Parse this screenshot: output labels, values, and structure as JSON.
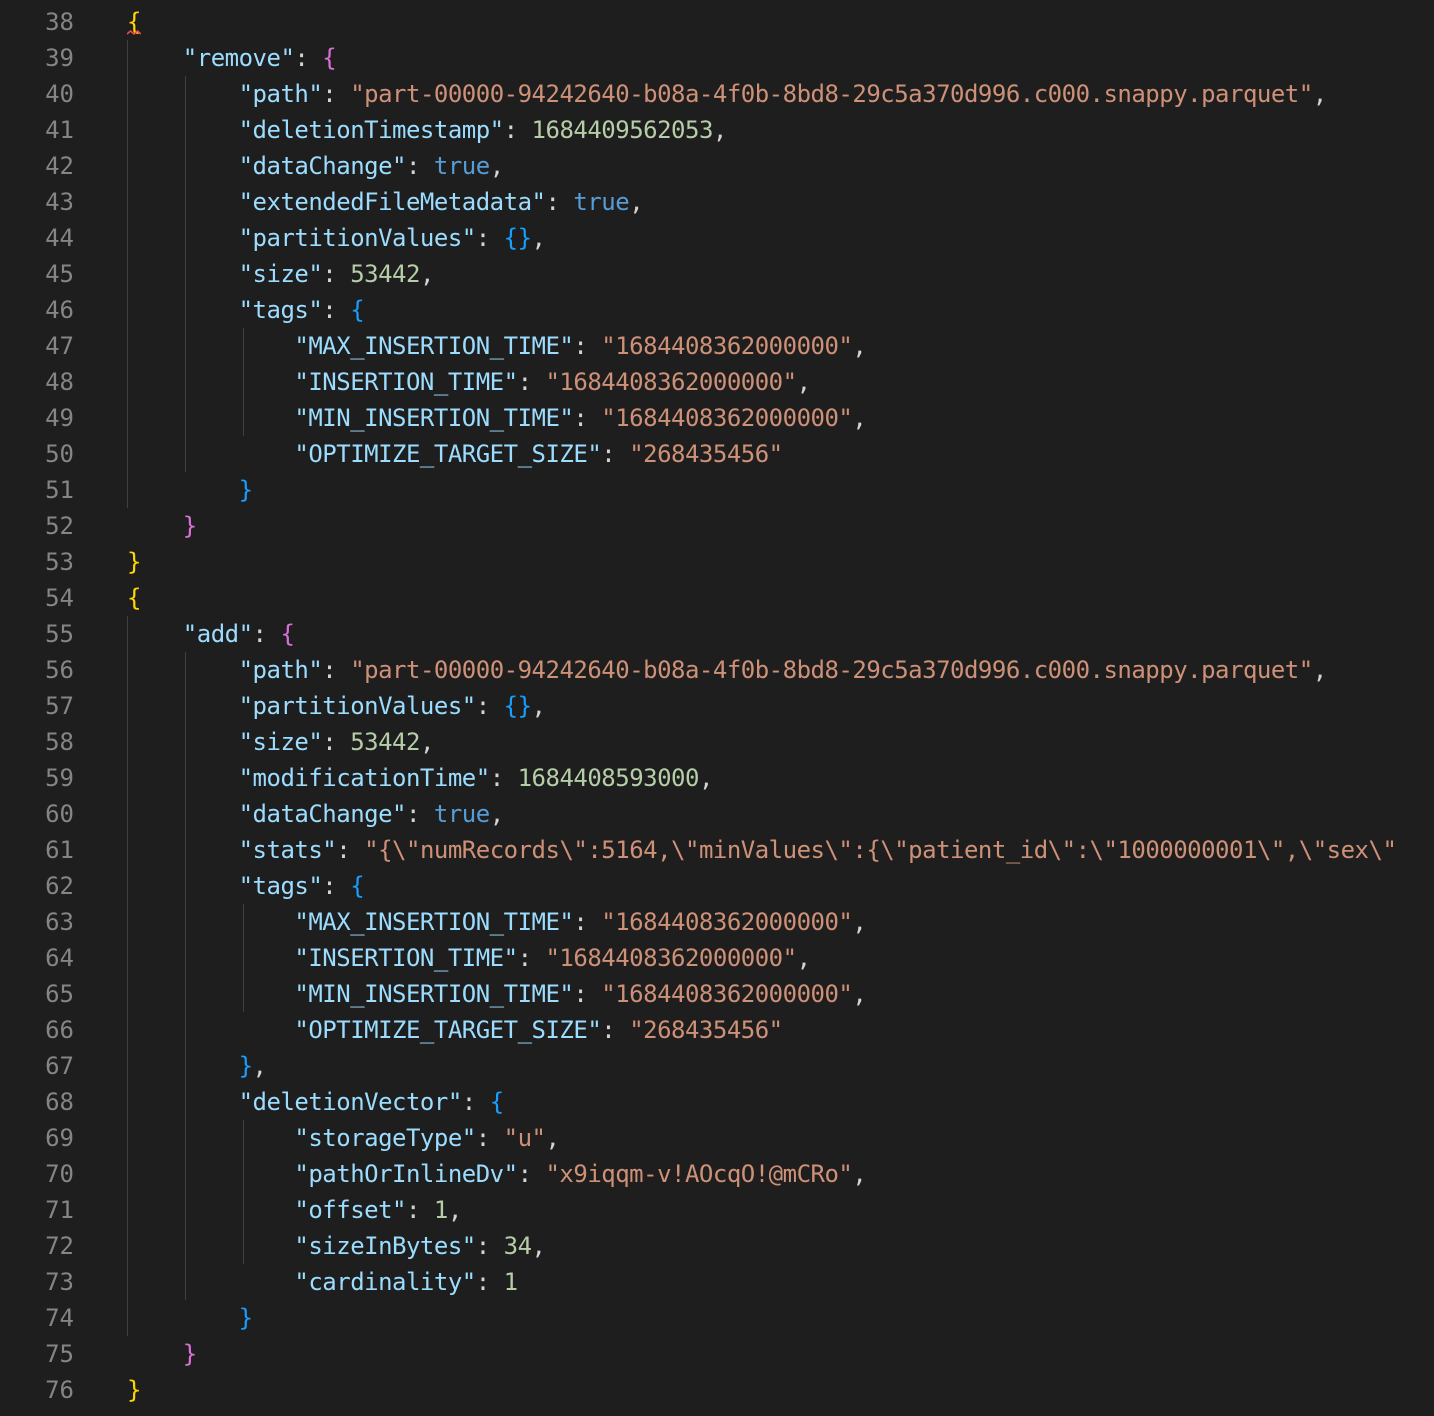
{
  "editor": {
    "language": "json",
    "theme_colors": {
      "background": "#1e1e1e",
      "line_number": "#858585",
      "punctuation": "#d4d4d4",
      "bracket_level1": "#ffd700",
      "bracket_level2": "#da70d6",
      "bracket_level3": "#179fff",
      "key": "#9cdcfe",
      "string": "#ce9178",
      "number": "#b5cea8",
      "keyword": "#569cd6"
    },
    "lines": [
      {
        "n": "38",
        "tokens": [
          [
            "b1",
            "{"
          ]
        ]
      },
      {
        "n": "39",
        "tokens": [
          [
            "pun",
            "    "
          ],
          [
            "key",
            "\"remove\""
          ],
          [
            "pun",
            ": "
          ],
          [
            "b2",
            "{"
          ]
        ]
      },
      {
        "n": "40",
        "tokens": [
          [
            "pun",
            "        "
          ],
          [
            "key",
            "\"path\""
          ],
          [
            "pun",
            ": "
          ],
          [
            "str",
            "\"part-00000-94242640-b08a-4f0b-8bd8-29c5a370d996.c000.snappy.parquet\""
          ],
          [
            "pun",
            ","
          ]
        ]
      },
      {
        "n": "41",
        "tokens": [
          [
            "pun",
            "        "
          ],
          [
            "key",
            "\"deletionTimestamp\""
          ],
          [
            "pun",
            ": "
          ],
          [
            "num",
            "1684409562053"
          ],
          [
            "pun",
            ","
          ]
        ]
      },
      {
        "n": "42",
        "tokens": [
          [
            "pun",
            "        "
          ],
          [
            "key",
            "\"dataChange\""
          ],
          [
            "pun",
            ": "
          ],
          [
            "kw",
            "true"
          ],
          [
            "pun",
            ","
          ]
        ]
      },
      {
        "n": "43",
        "tokens": [
          [
            "pun",
            "        "
          ],
          [
            "key",
            "\"extendedFileMetadata\""
          ],
          [
            "pun",
            ": "
          ],
          [
            "kw",
            "true"
          ],
          [
            "pun",
            ","
          ]
        ]
      },
      {
        "n": "44",
        "tokens": [
          [
            "pun",
            "        "
          ],
          [
            "key",
            "\"partitionValues\""
          ],
          [
            "pun",
            ": "
          ],
          [
            "b3",
            "{}"
          ],
          [
            "pun",
            ","
          ]
        ]
      },
      {
        "n": "45",
        "tokens": [
          [
            "pun",
            "        "
          ],
          [
            "key",
            "\"size\""
          ],
          [
            "pun",
            ": "
          ],
          [
            "num",
            "53442"
          ],
          [
            "pun",
            ","
          ]
        ]
      },
      {
        "n": "46",
        "tokens": [
          [
            "pun",
            "        "
          ],
          [
            "key",
            "\"tags\""
          ],
          [
            "pun",
            ": "
          ],
          [
            "b3",
            "{"
          ]
        ]
      },
      {
        "n": "47",
        "tokens": [
          [
            "pun",
            "            "
          ],
          [
            "key",
            "\"MAX_INSERTION_TIME\""
          ],
          [
            "pun",
            ": "
          ],
          [
            "str",
            "\"1684408362000000\""
          ],
          [
            "pun",
            ","
          ]
        ]
      },
      {
        "n": "48",
        "tokens": [
          [
            "pun",
            "            "
          ],
          [
            "key",
            "\"INSERTION_TIME\""
          ],
          [
            "pun",
            ": "
          ],
          [
            "str",
            "\"1684408362000000\""
          ],
          [
            "pun",
            ","
          ]
        ]
      },
      {
        "n": "49",
        "tokens": [
          [
            "pun",
            "            "
          ],
          [
            "key",
            "\"MIN_INSERTION_TIME\""
          ],
          [
            "pun",
            ": "
          ],
          [
            "str",
            "\"1684408362000000\""
          ],
          [
            "pun",
            ","
          ]
        ]
      },
      {
        "n": "50",
        "tokens": [
          [
            "pun",
            "            "
          ],
          [
            "key",
            "\"OPTIMIZE_TARGET_SIZE\""
          ],
          [
            "pun",
            ": "
          ],
          [
            "str",
            "\"268435456\""
          ]
        ]
      },
      {
        "n": "51",
        "tokens": [
          [
            "pun",
            "        "
          ],
          [
            "b3",
            "}"
          ]
        ]
      },
      {
        "n": "52",
        "tokens": [
          [
            "pun",
            "    "
          ],
          [
            "b2",
            "}"
          ]
        ]
      },
      {
        "n": "53",
        "tokens": [
          [
            "b1",
            "}"
          ]
        ]
      },
      {
        "n": "54",
        "tokens": [
          [
            "b1",
            "{"
          ]
        ]
      },
      {
        "n": "55",
        "tokens": [
          [
            "pun",
            "    "
          ],
          [
            "key",
            "\"add\""
          ],
          [
            "pun",
            ": "
          ],
          [
            "b2",
            "{"
          ]
        ]
      },
      {
        "n": "56",
        "tokens": [
          [
            "pun",
            "        "
          ],
          [
            "key",
            "\"path\""
          ],
          [
            "pun",
            ": "
          ],
          [
            "str",
            "\"part-00000-94242640-b08a-4f0b-8bd8-29c5a370d996.c000.snappy.parquet\""
          ],
          [
            "pun",
            ","
          ]
        ]
      },
      {
        "n": "57",
        "tokens": [
          [
            "pun",
            "        "
          ],
          [
            "key",
            "\"partitionValues\""
          ],
          [
            "pun",
            ": "
          ],
          [
            "b3",
            "{}"
          ],
          [
            "pun",
            ","
          ]
        ]
      },
      {
        "n": "58",
        "tokens": [
          [
            "pun",
            "        "
          ],
          [
            "key",
            "\"size\""
          ],
          [
            "pun",
            ": "
          ],
          [
            "num",
            "53442"
          ],
          [
            "pun",
            ","
          ]
        ]
      },
      {
        "n": "59",
        "tokens": [
          [
            "pun",
            "        "
          ],
          [
            "key",
            "\"modificationTime\""
          ],
          [
            "pun",
            ": "
          ],
          [
            "num",
            "1684408593000"
          ],
          [
            "pun",
            ","
          ]
        ]
      },
      {
        "n": "60",
        "tokens": [
          [
            "pun",
            "        "
          ],
          [
            "key",
            "\"dataChange\""
          ],
          [
            "pun",
            ": "
          ],
          [
            "kw",
            "true"
          ],
          [
            "pun",
            ","
          ]
        ]
      },
      {
        "n": "61",
        "tokens": [
          [
            "pun",
            "        "
          ],
          [
            "key",
            "\"stats\""
          ],
          [
            "pun",
            ": "
          ],
          [
            "str",
            "\"{\\\"numRecords\\\":5164,\\\"minValues\\\":{\\\"patient_id\\\":\\\"1000000001\\\",\\\"sex\\\""
          ]
        ]
      },
      {
        "n": "62",
        "tokens": [
          [
            "pun",
            "        "
          ],
          [
            "key",
            "\"tags\""
          ],
          [
            "pun",
            ": "
          ],
          [
            "b3",
            "{"
          ]
        ]
      },
      {
        "n": "63",
        "tokens": [
          [
            "pun",
            "            "
          ],
          [
            "key",
            "\"MAX_INSERTION_TIME\""
          ],
          [
            "pun",
            ": "
          ],
          [
            "str",
            "\"1684408362000000\""
          ],
          [
            "pun",
            ","
          ]
        ]
      },
      {
        "n": "64",
        "tokens": [
          [
            "pun",
            "            "
          ],
          [
            "key",
            "\"INSERTION_TIME\""
          ],
          [
            "pun",
            ": "
          ],
          [
            "str",
            "\"1684408362000000\""
          ],
          [
            "pun",
            ","
          ]
        ]
      },
      {
        "n": "65",
        "tokens": [
          [
            "pun",
            "            "
          ],
          [
            "key",
            "\"MIN_INSERTION_TIME\""
          ],
          [
            "pun",
            ": "
          ],
          [
            "str",
            "\"1684408362000000\""
          ],
          [
            "pun",
            ","
          ]
        ]
      },
      {
        "n": "66",
        "tokens": [
          [
            "pun",
            "            "
          ],
          [
            "key",
            "\"OPTIMIZE_TARGET_SIZE\""
          ],
          [
            "pun",
            ": "
          ],
          [
            "str",
            "\"268435456\""
          ]
        ]
      },
      {
        "n": "67",
        "tokens": [
          [
            "pun",
            "        "
          ],
          [
            "b3",
            "}"
          ],
          [
            "pun",
            ","
          ]
        ]
      },
      {
        "n": "68",
        "tokens": [
          [
            "pun",
            "        "
          ],
          [
            "key",
            "\"deletionVector\""
          ],
          [
            "pun",
            ": "
          ],
          [
            "b3",
            "{"
          ]
        ]
      },
      {
        "n": "69",
        "tokens": [
          [
            "pun",
            "            "
          ],
          [
            "key",
            "\"storageType\""
          ],
          [
            "pun",
            ": "
          ],
          [
            "str",
            "\"u\""
          ],
          [
            "pun",
            ","
          ]
        ]
      },
      {
        "n": "70",
        "tokens": [
          [
            "pun",
            "            "
          ],
          [
            "key",
            "\"pathOrInlineDv\""
          ],
          [
            "pun",
            ": "
          ],
          [
            "str",
            "\"x9iqqm-v!AOcqO!@mCRo\""
          ],
          [
            "pun",
            ","
          ]
        ]
      },
      {
        "n": "71",
        "tokens": [
          [
            "pun",
            "            "
          ],
          [
            "key",
            "\"offset\""
          ],
          [
            "pun",
            ": "
          ],
          [
            "num",
            "1"
          ],
          [
            "pun",
            ","
          ]
        ]
      },
      {
        "n": "72",
        "tokens": [
          [
            "pun",
            "            "
          ],
          [
            "key",
            "\"sizeInBytes\""
          ],
          [
            "pun",
            ": "
          ],
          [
            "num",
            "34"
          ],
          [
            "pun",
            ","
          ]
        ]
      },
      {
        "n": "73",
        "tokens": [
          [
            "pun",
            "            "
          ],
          [
            "key",
            "\"cardinality\""
          ],
          [
            "pun",
            ": "
          ],
          [
            "num",
            "1"
          ]
        ]
      },
      {
        "n": "74",
        "tokens": [
          [
            "pun",
            "        "
          ],
          [
            "b3",
            "}"
          ]
        ]
      },
      {
        "n": "75",
        "tokens": [
          [
            "pun",
            "    "
          ],
          [
            "b2",
            "}"
          ]
        ]
      },
      {
        "n": "76",
        "tokens": [
          [
            "b1",
            "}"
          ]
        ]
      }
    ]
  }
}
